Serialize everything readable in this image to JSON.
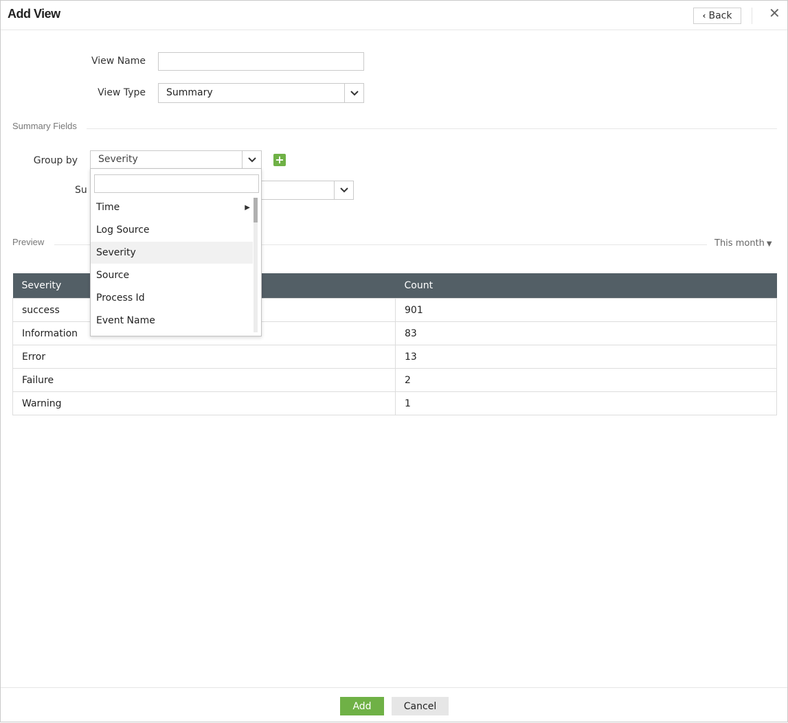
{
  "dialog": {
    "title": "Add View",
    "back_label": "Back"
  },
  "form": {
    "view_name_label": "View Name",
    "view_name_value": "",
    "view_type_label": "View Type",
    "view_type_value": "Summary"
  },
  "summary": {
    "section_title": "Summary Fields",
    "group_by_label": "Group by",
    "group_by_value": "Severity",
    "second_label_partial": "Su",
    "second_value": ""
  },
  "dropdown": {
    "search_value": "",
    "items": [
      {
        "label": "Time",
        "has_submenu": true
      },
      {
        "label": "Log Source",
        "has_submenu": false
      },
      {
        "label": "Severity",
        "has_submenu": false,
        "highlighted": true
      },
      {
        "label": "Source",
        "has_submenu": false
      },
      {
        "label": "Process Id",
        "has_submenu": false
      },
      {
        "label": "Event Name",
        "has_submenu": false
      }
    ]
  },
  "preview": {
    "section_title": "Preview",
    "range_label": "This month",
    "columns": [
      "Severity",
      "Count"
    ],
    "rows": [
      [
        "success",
        "901"
      ],
      [
        "Information",
        "83"
      ],
      [
        "Error",
        "13"
      ],
      [
        "Failure",
        "2"
      ],
      [
        "Warning",
        "1"
      ]
    ]
  },
  "footer": {
    "add_label": "Add",
    "cancel_label": "Cancel"
  },
  "colors": {
    "accent_green": "#6fb146",
    "table_header": "#535f66"
  },
  "icons": [
    "chevron-left-icon",
    "close-icon",
    "chevron-down-icon",
    "plus-icon",
    "caret-down-icon",
    "caret-right-icon"
  ]
}
